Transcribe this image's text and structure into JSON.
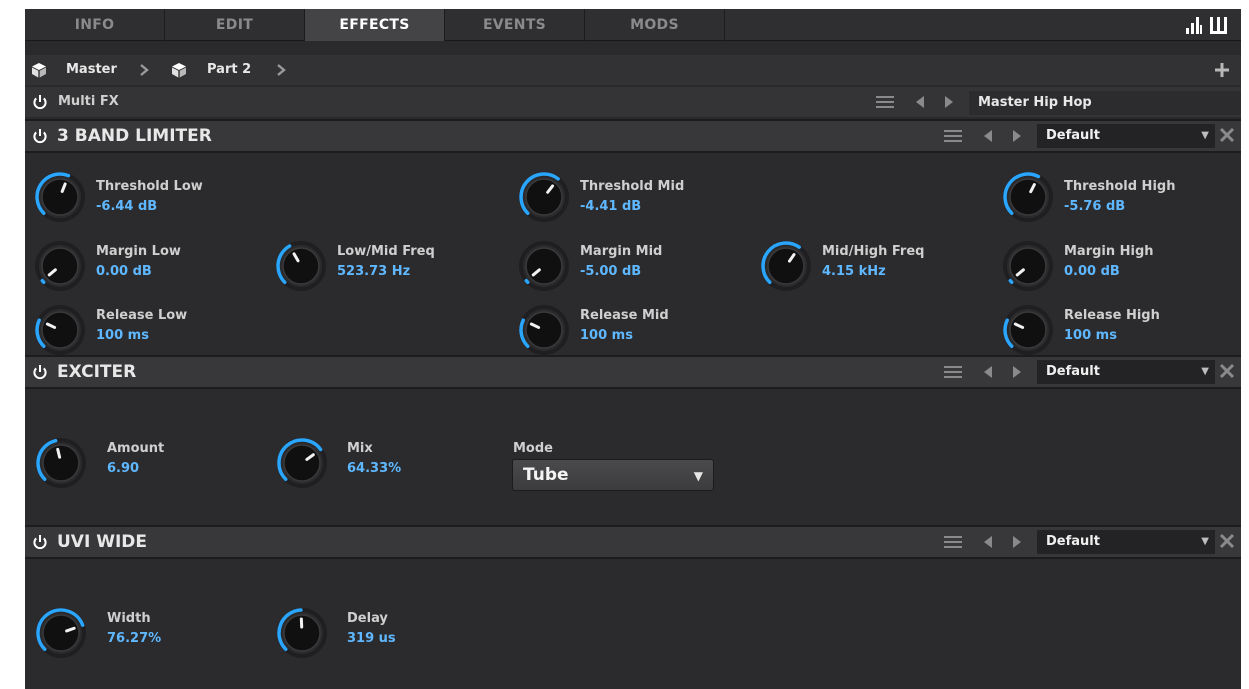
{
  "tabs": [
    {
      "label": "INFO"
    },
    {
      "label": "EDIT"
    },
    {
      "label": "EFFECTS"
    },
    {
      "label": "EVENTS"
    },
    {
      "label": "MODS"
    }
  ],
  "active_tab": "EFFECTS",
  "top_icons": [
    "bars-chart-icon",
    "piano-keys-icon"
  ],
  "breadcrumb": {
    "items": [
      "Master",
      "Part 2"
    ],
    "add_icon": "plus-icon"
  },
  "multifx": {
    "title": "Multi FX",
    "preset": "Master Hip Hop"
  },
  "sections": {
    "limiter": {
      "title": "3 BAND LIMITER",
      "preset": "Default",
      "knobs": {
        "threshold_low": {
          "label": "Threshold Low",
          "value": "-6.44 dB",
          "level": 0.58
        },
        "threshold_mid": {
          "label": "Threshold Mid",
          "value": "-4.41 dB",
          "level": 0.64
        },
        "threshold_high": {
          "label": "Threshold High",
          "value": "-5.76 dB",
          "level": 0.6
        },
        "margin_low": {
          "label": "Margin Low",
          "value": "0.00 dB",
          "level": 0.02
        },
        "low_mid_freq": {
          "label": "Low/Mid Freq",
          "value": "523.73 Hz",
          "level": 0.39
        },
        "margin_mid": {
          "label": "Margin Mid",
          "value": "-5.00 dB",
          "level": 0.02
        },
        "mid_high_freq": {
          "label": "Mid/High Freq",
          "value": "4.15 kHz",
          "level": 0.63
        },
        "margin_high": {
          "label": "Margin High",
          "value": "0.00 dB",
          "level": 0.02
        },
        "release_low": {
          "label": "Release Low",
          "value": "100 ms",
          "level": 0.26
        },
        "release_mid": {
          "label": "Release Mid",
          "value": "100 ms",
          "level": 0.26
        },
        "release_high": {
          "label": "Release High",
          "value": "100 ms",
          "level": 0.26
        }
      }
    },
    "exciter": {
      "title": "EXCITER",
      "preset": "Default",
      "knobs": {
        "amount": {
          "label": "Amount",
          "value": "6.90",
          "level": 0.45
        },
        "mix": {
          "label": "Mix",
          "value": "64.33%",
          "level": 0.7
        }
      },
      "mode": {
        "label": "Mode",
        "value": "Tube"
      }
    },
    "wide": {
      "title": "UVI WIDE",
      "preset": "Default",
      "knobs": {
        "width": {
          "label": "Width",
          "value": "76.27%",
          "level": 0.76
        },
        "delay": {
          "label": "Delay",
          "value": "319 us",
          "level": 0.49
        }
      }
    }
  },
  "colors": {
    "accent": "#2aa6ff",
    "value_text": "#5fb8ff",
    "panel": "#2b2b2d",
    "header": "#38383a",
    "active_tab": "#444446"
  }
}
